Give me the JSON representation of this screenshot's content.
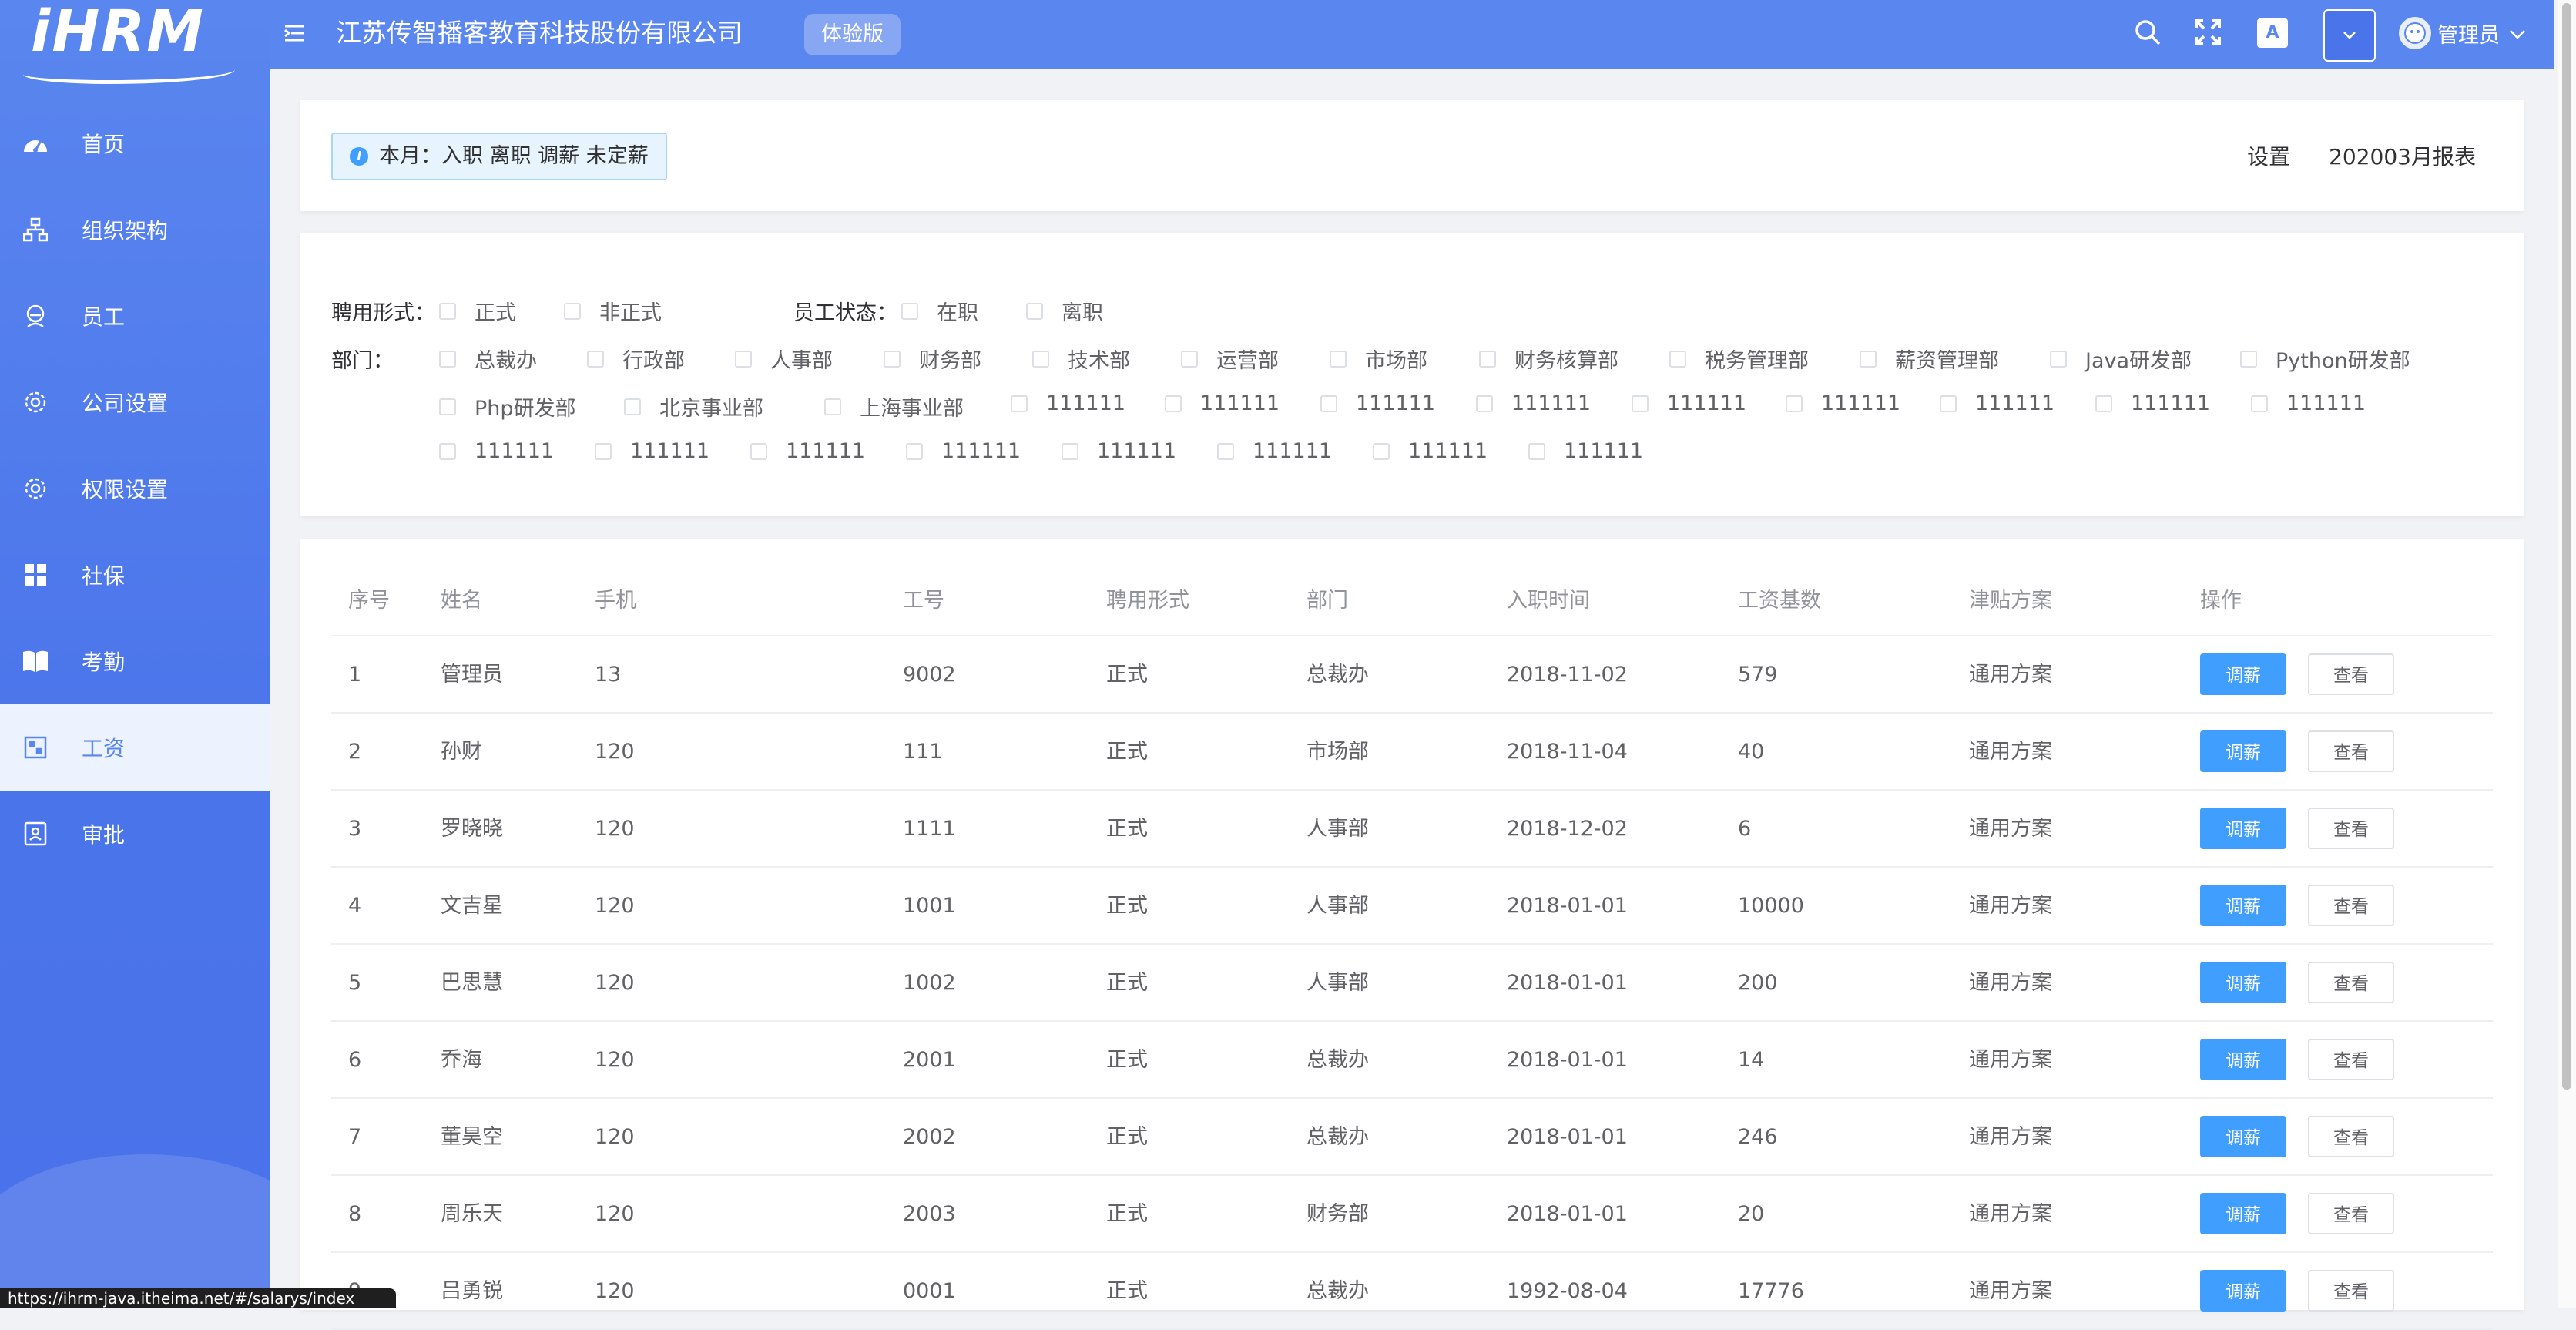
{
  "logo": {
    "text": "iHRM"
  },
  "sidebar": {
    "items": [
      {
        "label": "首页",
        "icon": "dashboard-icon"
      },
      {
        "label": "组织架构",
        "icon": "org-chart-icon"
      },
      {
        "label": "员工",
        "icon": "employee-icon"
      },
      {
        "label": "公司设置",
        "icon": "gear-icon"
      },
      {
        "label": "权限设置",
        "icon": "gear-icon"
      },
      {
        "label": "社保",
        "icon": "grid-icon"
      },
      {
        "label": "考勤",
        "icon": "book-icon"
      },
      {
        "label": "工资",
        "icon": "salary-icon",
        "active": true
      },
      {
        "label": "审批",
        "icon": "approval-icon"
      }
    ]
  },
  "header": {
    "company": "江苏传智播客教育科技股份有限公司",
    "tag": "体验版",
    "user": "管理员",
    "lang_icon_text": "A"
  },
  "summary": {
    "alert": "本月：入职 离职 调薪 未定薪",
    "settings_link": "设置",
    "report_link": "202003月报表"
  },
  "filters": {
    "employment_label": "聘用形式：",
    "employment_options": [
      "正式",
      "非正式"
    ],
    "status_label": "员工状态：",
    "status_options": [
      "在职",
      "离职"
    ],
    "dept_label": "部门：",
    "departments": [
      [
        "总裁办",
        "行政部",
        "人事部",
        "财务部",
        "技术部",
        "运营部",
        "市场部",
        "财务核算部",
        "税务管理部",
        "薪资管理部",
        "Java研发部",
        "Python研发部"
      ],
      [
        "Php研发部",
        "北京事业部",
        "上海事业部",
        "111111",
        "111111",
        "111111",
        "111111",
        "111111",
        "111111",
        "111111",
        "111111",
        "111111"
      ],
      [
        "111111",
        "111111",
        "111111",
        "111111",
        "111111",
        "111111",
        "111111",
        "111111"
      ]
    ]
  },
  "table": {
    "headers": [
      "序号",
      "姓名",
      "手机",
      "工号",
      "聘用形式",
      "部门",
      "入职时间",
      "工资基数",
      "津贴方案",
      "操作"
    ],
    "action_adjust": "调薪",
    "action_view": "查看",
    "rows": [
      [
        "1",
        "管理员",
        "13",
        "9002",
        "正式",
        "总裁办",
        "2018-11-02",
        "579",
        "通用方案"
      ],
      [
        "2",
        "孙财",
        "120",
        "111",
        "正式",
        "市场部",
        "2018-11-04",
        "40",
        "通用方案"
      ],
      [
        "3",
        "罗晓晓",
        "120",
        "1111",
        "正式",
        "人事部",
        "2018-12-02",
        "6",
        "通用方案"
      ],
      [
        "4",
        "文吉星",
        "120",
        "1001",
        "正式",
        "人事部",
        "2018-01-01",
        "10000",
        "通用方案"
      ],
      [
        "5",
        "巴思慧",
        "120",
        "1002",
        "正式",
        "人事部",
        "2018-01-01",
        "200",
        "通用方案"
      ],
      [
        "6",
        "乔海",
        "120",
        "2001",
        "正式",
        "总裁办",
        "2018-01-01",
        "14",
        "通用方案"
      ],
      [
        "7",
        "董昊空",
        "120",
        "2002",
        "正式",
        "总裁办",
        "2018-01-01",
        "246",
        "通用方案"
      ],
      [
        "8",
        "周乐天",
        "120",
        "2003",
        "正式",
        "财务部",
        "2018-01-01",
        "20",
        "通用方案"
      ],
      [
        "9",
        "吕勇锐",
        "120",
        "0001",
        "正式",
        "总裁办",
        "1992-08-04",
        "17776",
        "通用方案"
      ]
    ]
  },
  "status_bar": {
    "url": "https://ihrm-java.itheima.net/#/salarys/index"
  },
  "colors": {
    "primary": "#5a86ef",
    "button": "#409eff",
    "active_bg": "#ecf3ff"
  }
}
